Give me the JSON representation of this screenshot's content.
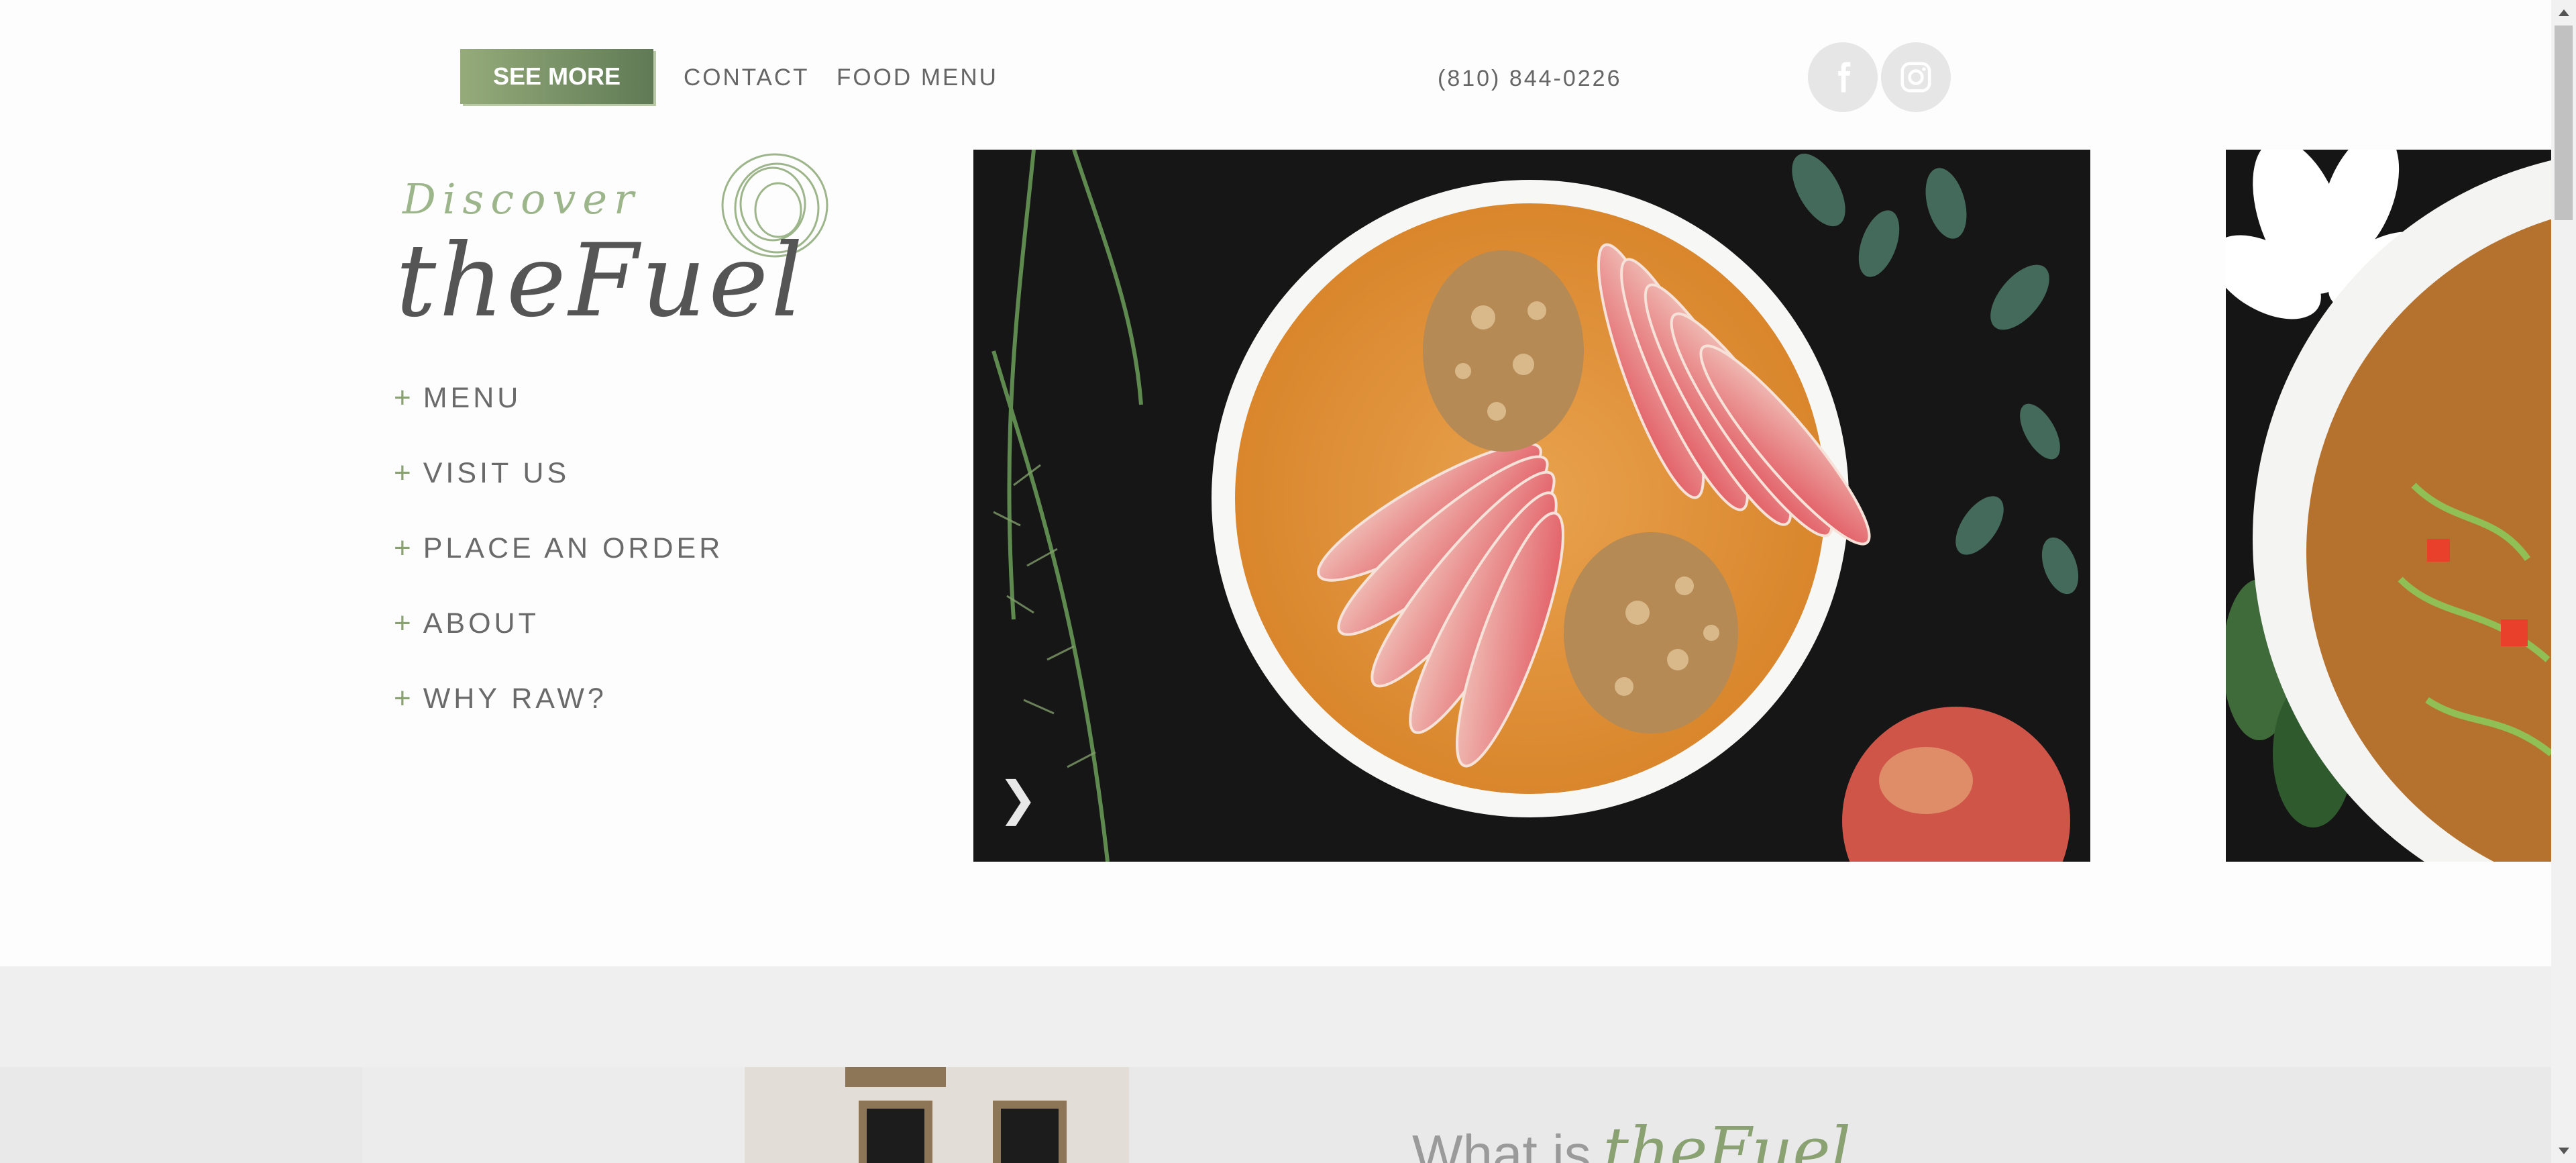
{
  "header": {
    "see_more_label": "SEE MORE",
    "contact_label": "CONTACT",
    "food_menu_label": "FOOD MENU",
    "phone": "(810) 844-0226",
    "social": [
      "facebook-icon",
      "instagram-icon"
    ]
  },
  "logo": {
    "script_top": "Discover",
    "script_main": "theFuel"
  },
  "sidenav": {
    "items": [
      {
        "plus": "+",
        "label": "MENU"
      },
      {
        "plus": "+",
        "label": "VISIT US"
      },
      {
        "plus": "+",
        "label": "PLACE AN ORDER"
      },
      {
        "plus": "+",
        "label": "ABOUT"
      },
      {
        "plus": "+",
        "label": "WHY RAW?"
      }
    ]
  },
  "slider": {
    "next_arrow": "❯"
  },
  "section": {
    "heading_lead": "What is",
    "heading_brand": "theFuel"
  },
  "colors": {
    "accent_green": "#8aa172",
    "button_dark": "#5f7a55",
    "text_grey": "#6a6a6a"
  }
}
